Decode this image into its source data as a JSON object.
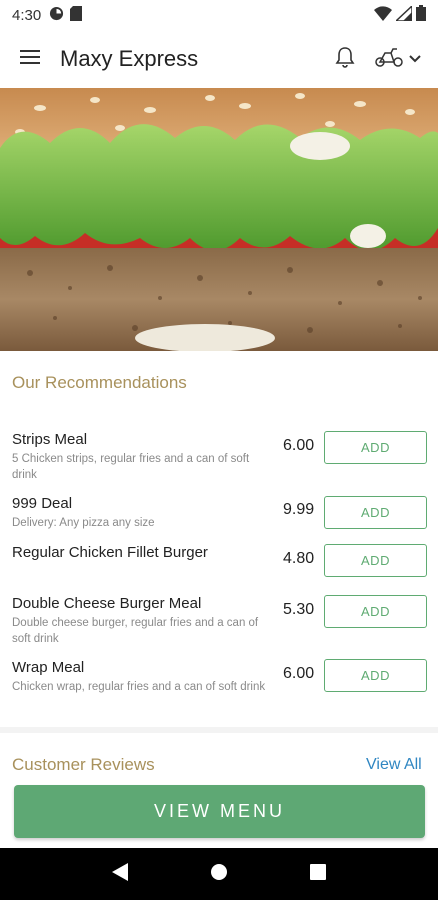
{
  "status_bar": {
    "time": "4:30",
    "icons": [
      "data-saver-icon",
      "sd-card-icon",
      "wifi-icon",
      "signal-icon",
      "battery-icon"
    ]
  },
  "app_bar": {
    "title": "Maxy Express",
    "icons": [
      "menu-icon",
      "bell-icon",
      "scooter-icon",
      "chevron-down-icon"
    ]
  },
  "recommendations": {
    "title": "Our Recommendations",
    "items": [
      {
        "name": "Strips Meal",
        "description": "5 Chicken strips, regular fries and a can of soft drink",
        "price": "6.00",
        "button": "ADD"
      },
      {
        "name": "999 Deal",
        "description": "Delivery: Any pizza any size",
        "price": "9.99",
        "button": "ADD"
      },
      {
        "name": "Regular Chicken Fillet Burger",
        "description": "",
        "price": "4.80",
        "button": "ADD"
      },
      {
        "name": "Double Cheese Burger Meal",
        "description": "Double cheese burger, regular fries and a can of soft drink",
        "price": "5.30",
        "button": "ADD"
      },
      {
        "name": "Wrap Meal",
        "description": "Chicken wrap, regular fries and a can of soft drink",
        "price": "6.00",
        "button": "ADD"
      }
    ]
  },
  "reviews": {
    "title": "Customer Reviews",
    "view_all": "View All"
  },
  "footer_button": "VIEW MENU",
  "colors": {
    "accent_green": "#5ea874",
    "section_title": "#a8915c",
    "link_blue": "#2f86c2"
  },
  "nav_bar": {
    "icons": [
      "back-icon",
      "home-icon",
      "recents-icon"
    ]
  }
}
